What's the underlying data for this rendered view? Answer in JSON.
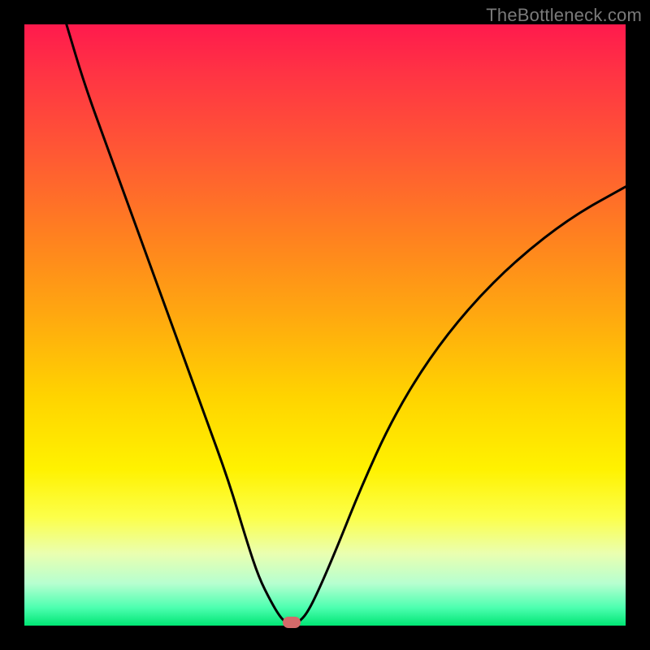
{
  "watermark": "TheBottleneck.com",
  "colors": {
    "frame_bg": "#000000",
    "curve_stroke": "#000000",
    "marker_fill": "#d46a6a"
  },
  "chart_data": {
    "type": "line",
    "title": "",
    "xlabel": "",
    "ylabel": "",
    "xlim": [
      0,
      100
    ],
    "ylim": [
      0,
      100
    ],
    "grid": false,
    "legend": false,
    "series": [
      {
        "name": "bottleneck-curve",
        "x": [
          7,
          10,
          14,
          18,
          22,
          26,
          30,
          34,
          37,
          39,
          41,
          42.5,
          43.5,
          44,
          44.5,
          45.5,
          47,
          49,
          52,
          56,
          61,
          67,
          74,
          82,
          91,
          100
        ],
        "y": [
          100,
          90,
          79,
          68,
          57,
          46,
          35,
          24,
          14,
          8,
          4,
          1.5,
          0.5,
          0,
          0,
          0.5,
          2,
          6,
          13,
          23,
          34,
          44,
          53,
          61,
          68,
          73
        ]
      }
    ],
    "marker": {
      "x": 44.5,
      "y": 0.5
    },
    "gradient_stops": [
      {
        "pos": 0,
        "color": "#ff1a4d"
      },
      {
        "pos": 35,
        "color": "#ff8020"
      },
      {
        "pos": 62,
        "color": "#ffd400"
      },
      {
        "pos": 88,
        "color": "#eaffb0"
      },
      {
        "pos": 100,
        "color": "#00e574"
      }
    ]
  }
}
